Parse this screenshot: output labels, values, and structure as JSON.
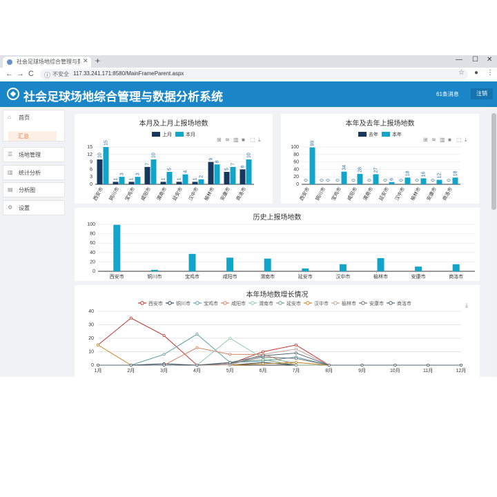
{
  "browser": {
    "tab_title": "社会足球场地综合管理与数据分析系统",
    "new_tab": "+",
    "back": "←",
    "forward": "→",
    "reload": "C",
    "security": "不安全",
    "url": "117.33.241.171:8580/MainFrameParent.aspx",
    "win_min": "—",
    "win_max": "☐",
    "win_close": "✕"
  },
  "app": {
    "title": "社会足球场地综合管理与数据分析系统",
    "messages": "61条消息",
    "logout": "注销"
  },
  "sidebar": {
    "items": [
      {
        "label": "首页",
        "icon": "home-icon"
      },
      {
        "label": "场地管理",
        "icon": "list-icon"
      },
      {
        "label": "统计分析",
        "icon": "bar-chart-icon"
      },
      {
        "label": "分析图",
        "icon": "chart-icon"
      },
      {
        "label": "设置",
        "icon": "gear-icon"
      }
    ],
    "sub_item": "汇总"
  },
  "colors": {
    "dark": "#16375e",
    "cyan": "#13a5c9",
    "header": "#1a86c8"
  },
  "chart_data": [
    {
      "type": "bar",
      "title": "本月及上月上报场地数",
      "legend": [
        "上月",
        "本月"
      ],
      "categories": [
        "西安市",
        "铜川市",
        "宝鸡市",
        "咸阳市",
        "渭南市",
        "延安市",
        "汉中市",
        "榆林市",
        "安康市",
        "商洛市"
      ],
      "series": [
        {
          "name": "上月",
          "values": [
            10,
            1,
            1,
            7,
            1,
            1,
            1,
            9,
            5,
            6
          ]
        },
        {
          "name": "本月",
          "values": [
            15,
            3,
            3,
            10,
            5,
            4,
            2,
            8,
            7,
            10
          ]
        }
      ],
      "ylim": [
        0,
        15
      ],
      "yticks": [
        0,
        3,
        6,
        9,
        12,
        15
      ]
    },
    {
      "type": "bar",
      "title": "本年及去年上报场地数",
      "legend": [
        "去年",
        "本年"
      ],
      "categories": [
        "西安市",
        "铜川市",
        "宝鸡市",
        "咸阳市",
        "渭南市",
        "延安市",
        "汉中市",
        "榆林市",
        "安康市",
        "商洛市"
      ],
      "series": [
        {
          "name": "去年",
          "values": [
            0,
            0,
            0,
            0,
            0,
            0,
            0,
            0,
            0,
            0
          ]
        },
        {
          "name": "本年",
          "values": [
            99,
            0,
            34,
            28,
            27,
            6,
            18,
            16,
            12,
            18
          ]
        }
      ],
      "ylim": [
        0,
        100
      ],
      "yticks": [
        0,
        20,
        40,
        60,
        80,
        100
      ]
    },
    {
      "type": "bar",
      "title": "历史上报场地数",
      "categories": [
        "西安市",
        "铜川市",
        "宝鸡市",
        "咸阳市",
        "渭南市",
        "延安市",
        "汉中市",
        "榆林市",
        "安康市",
        "商洛市"
      ],
      "values": [
        99,
        3,
        37,
        29,
        27,
        6,
        15,
        28,
        10,
        15
      ],
      "ylim": [
        0,
        100
      ],
      "yticks": [
        0,
        20,
        40,
        60,
        80,
        100
      ]
    },
    {
      "type": "line",
      "title": "本年场地数增长情况",
      "x": [
        "1月",
        "2月",
        "3月",
        "4月",
        "5月",
        "6月",
        "7月",
        "8月",
        "9月",
        "10月",
        "11月",
        "12月"
      ],
      "series": [
        {
          "name": "西安市",
          "color": "#c23531",
          "values": [
            15,
            35,
            22,
            0,
            1,
            10,
            15,
            0,
            0,
            0,
            0,
            0
          ]
        },
        {
          "name": "铜川市",
          "color": "#2f4554",
          "values": [
            0,
            0,
            1,
            0,
            0,
            2,
            0,
            0,
            0,
            0,
            0,
            0
          ]
        },
        {
          "name": "宝鸡市",
          "color": "#61a0a8",
          "values": [
            0,
            0,
            8,
            23,
            2,
            3,
            6,
            0,
            0,
            0,
            0,
            0
          ]
        },
        {
          "name": "咸阳市",
          "color": "#d48265",
          "values": [
            0,
            0,
            0,
            13,
            8,
            8,
            0,
            0,
            0,
            0,
            0,
            0
          ]
        },
        {
          "name": "渭南市",
          "color": "#91c7ae",
          "values": [
            0,
            0,
            0,
            0,
            20,
            5,
            2,
            0,
            0,
            0,
            0,
            0
          ]
        },
        {
          "name": "延安市",
          "color": "#749f83",
          "values": [
            0,
            0,
            0,
            0,
            2,
            4,
            0,
            0,
            0,
            0,
            0,
            0
          ]
        },
        {
          "name": "汉中市",
          "color": "#ca8622",
          "values": [
            15,
            0,
            0,
            0,
            0,
            1,
            2,
            0,
            0,
            0,
            0,
            0
          ]
        },
        {
          "name": "榆林市",
          "color": "#bda29a",
          "values": [
            0,
            0,
            0,
            0,
            0,
            8,
            12,
            0,
            0,
            0,
            0,
            0
          ]
        },
        {
          "name": "安康市",
          "color": "#6e7074",
          "values": [
            0,
            0,
            0,
            0,
            1,
            6,
            5,
            0,
            0,
            0,
            0,
            0
          ]
        },
        {
          "name": "商洛市",
          "color": "#546570",
          "values": [
            0,
            0,
            0,
            0,
            2,
            7,
            9,
            0,
            0,
            0,
            0,
            0
          ]
        }
      ],
      "ylim": [
        0,
        40
      ],
      "yticks": [
        0,
        10,
        20,
        30,
        40
      ]
    }
  ]
}
